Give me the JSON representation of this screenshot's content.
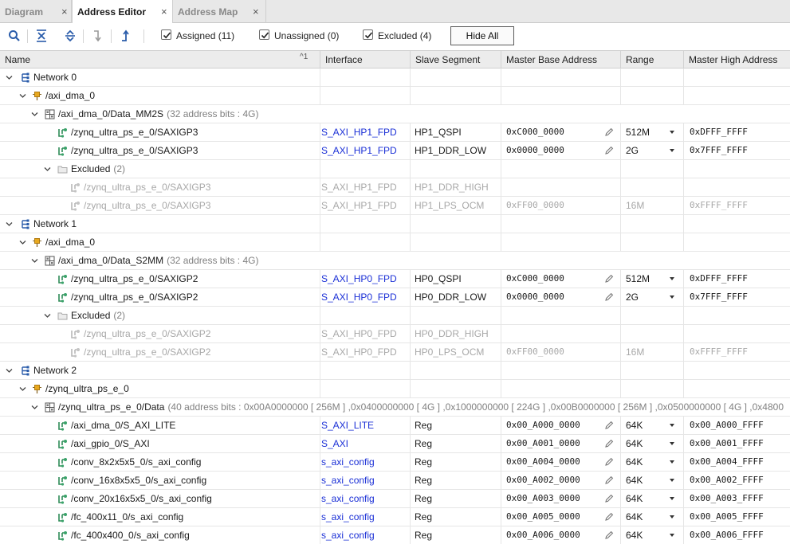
{
  "tabs": [
    {
      "label": "Diagram"
    },
    {
      "label": "Address Editor"
    },
    {
      "label": "Address Map"
    }
  ],
  "tab_close_glyph": "×",
  "toolbar": {
    "filters": [
      {
        "label": "Assigned (11)",
        "checked": true
      },
      {
        "label": "Unassigned (0)",
        "checked": true
      },
      {
        "label": "Excluded (4)",
        "checked": true
      }
    ],
    "hide_all_label": "Hide All"
  },
  "columns": {
    "name": "Name",
    "sort_indicator": "^1",
    "interface": "Interface",
    "slave_segment": "Slave Segment",
    "master_base": "Master Base Address",
    "range": "Range",
    "master_high": "Master High Address"
  },
  "rows": [
    {
      "type": "network",
      "name": "Network 0"
    },
    {
      "type": "master",
      "name": "/axi_dma_0"
    },
    {
      "type": "space",
      "name": "/axi_dma_0/Data_MM2S",
      "note": "(32 address bits : 4G)"
    },
    {
      "type": "seg",
      "name": "/zynq_ultra_ps_e_0/SAXIGP3",
      "iface": "S_AXI_HP1_FPD",
      "slave": "HP1_QSPI",
      "base": "0xC000_0000",
      "range": "512M",
      "high": "0xDFFF_FFFF"
    },
    {
      "type": "seg",
      "name": "/zynq_ultra_ps_e_0/SAXIGP3",
      "iface": "S_AXI_HP1_FPD",
      "slave": "HP1_DDR_LOW",
      "base": "0x0000_0000",
      "range": "2G",
      "high": "0x7FFF_FFFF"
    },
    {
      "type": "excluded",
      "name": "Excluded",
      "count": "(2)"
    },
    {
      "type": "exseg",
      "name": "/zynq_ultra_ps_e_0/SAXIGP3",
      "iface": "S_AXI_HP1_FPD",
      "slave": "HP1_DDR_HIGH",
      "base": "",
      "range": "",
      "high": ""
    },
    {
      "type": "exseg",
      "name": "/zynq_ultra_ps_e_0/SAXIGP3",
      "iface": "S_AXI_HP1_FPD",
      "slave": "HP1_LPS_OCM",
      "base": "0xFF00_0000",
      "range": "16M",
      "high": "0xFFFF_FFFF"
    },
    {
      "type": "network",
      "name": "Network 1"
    },
    {
      "type": "master",
      "name": "/axi_dma_0"
    },
    {
      "type": "space",
      "name": "/axi_dma_0/Data_S2MM",
      "note": "(32 address bits : 4G)"
    },
    {
      "type": "seg",
      "name": "/zynq_ultra_ps_e_0/SAXIGP2",
      "iface": "S_AXI_HP0_FPD",
      "slave": "HP0_QSPI",
      "base": "0xC000_0000",
      "range": "512M",
      "high": "0xDFFF_FFFF"
    },
    {
      "type": "seg",
      "name": "/zynq_ultra_ps_e_0/SAXIGP2",
      "iface": "S_AXI_HP0_FPD",
      "slave": "HP0_DDR_LOW",
      "base": "0x0000_0000",
      "range": "2G",
      "high": "0x7FFF_FFFF"
    },
    {
      "type": "excluded",
      "name": "Excluded",
      "count": "(2)"
    },
    {
      "type": "exseg",
      "name": "/zynq_ultra_ps_e_0/SAXIGP2",
      "iface": "S_AXI_HP0_FPD",
      "slave": "HP0_DDR_HIGH",
      "base": "",
      "range": "",
      "high": ""
    },
    {
      "type": "exseg",
      "name": "/zynq_ultra_ps_e_0/SAXIGP2",
      "iface": "S_AXI_HP0_FPD",
      "slave": "HP0_LPS_OCM",
      "base": "0xFF00_0000",
      "range": "16M",
      "high": "0xFFFF_FFFF"
    },
    {
      "type": "network",
      "name": "Network 2"
    },
    {
      "type": "master",
      "name": "/zynq_ultra_ps_e_0"
    },
    {
      "type": "space",
      "name": "/zynq_ultra_ps_e_0/Data",
      "note": "(40 address bits : 0x00A0000000 [ 256M ] ,0x0400000000 [ 4G ] ,0x1000000000 [ 224G ] ,0x00B0000000 [ 256M ] ,0x0500000000 [ 4G ] ,0x4800"
    },
    {
      "type": "seg",
      "name": "/axi_dma_0/S_AXI_LITE",
      "iface": "S_AXI_LITE",
      "slave": "Reg",
      "base": "0x00_A000_0000",
      "range": "64K",
      "high": "0x00_A000_FFFF"
    },
    {
      "type": "seg",
      "name": "/axi_gpio_0/S_AXI",
      "iface": "S_AXI",
      "slave": "Reg",
      "base": "0x00_A001_0000",
      "range": "64K",
      "high": "0x00_A001_FFFF"
    },
    {
      "type": "seg",
      "name": "/conv_8x2x5x5_0/s_axi_config",
      "iface": "s_axi_config",
      "slave": "Reg",
      "base": "0x00_A004_0000",
      "range": "64K",
      "high": "0x00_A004_FFFF"
    },
    {
      "type": "seg",
      "name": "/conv_16x8x5x5_0/s_axi_config",
      "iface": "s_axi_config",
      "slave": "Reg",
      "base": "0x00_A002_0000",
      "range": "64K",
      "high": "0x00_A002_FFFF"
    },
    {
      "type": "seg",
      "name": "/conv_20x16x5x5_0/s_axi_config",
      "iface": "s_axi_config",
      "slave": "Reg",
      "base": "0x00_A003_0000",
      "range": "64K",
      "high": "0x00_A003_FFFF"
    },
    {
      "type": "seg",
      "name": "/fc_400x11_0/s_axi_config",
      "iface": "s_axi_config",
      "slave": "Reg",
      "base": "0x00_A005_0000",
      "range": "64K",
      "high": "0x00_A005_FFFF"
    },
    {
      "type": "seg",
      "name": "/fc_400x400_0/s_axi_config",
      "iface": "s_axi_config",
      "slave": "Reg",
      "base": "0x00_A006_0000",
      "range": "64K",
      "high": "0x00_A006_FFFF"
    }
  ],
  "colors": {
    "link": "#1a2fd6",
    "segment_icon": "#2e8b57",
    "master_icon": "#e0a020",
    "excluded_text": "#a8a8a8"
  },
  "icons": {
    "network": "network-icon",
    "master": "master-icon",
    "space": "address-space-icon",
    "segment": "segment-icon",
    "excluded_folder": "folder-icon",
    "edit": "pencil-icon",
    "dropdown": "dropdown-arrow-icon"
  }
}
